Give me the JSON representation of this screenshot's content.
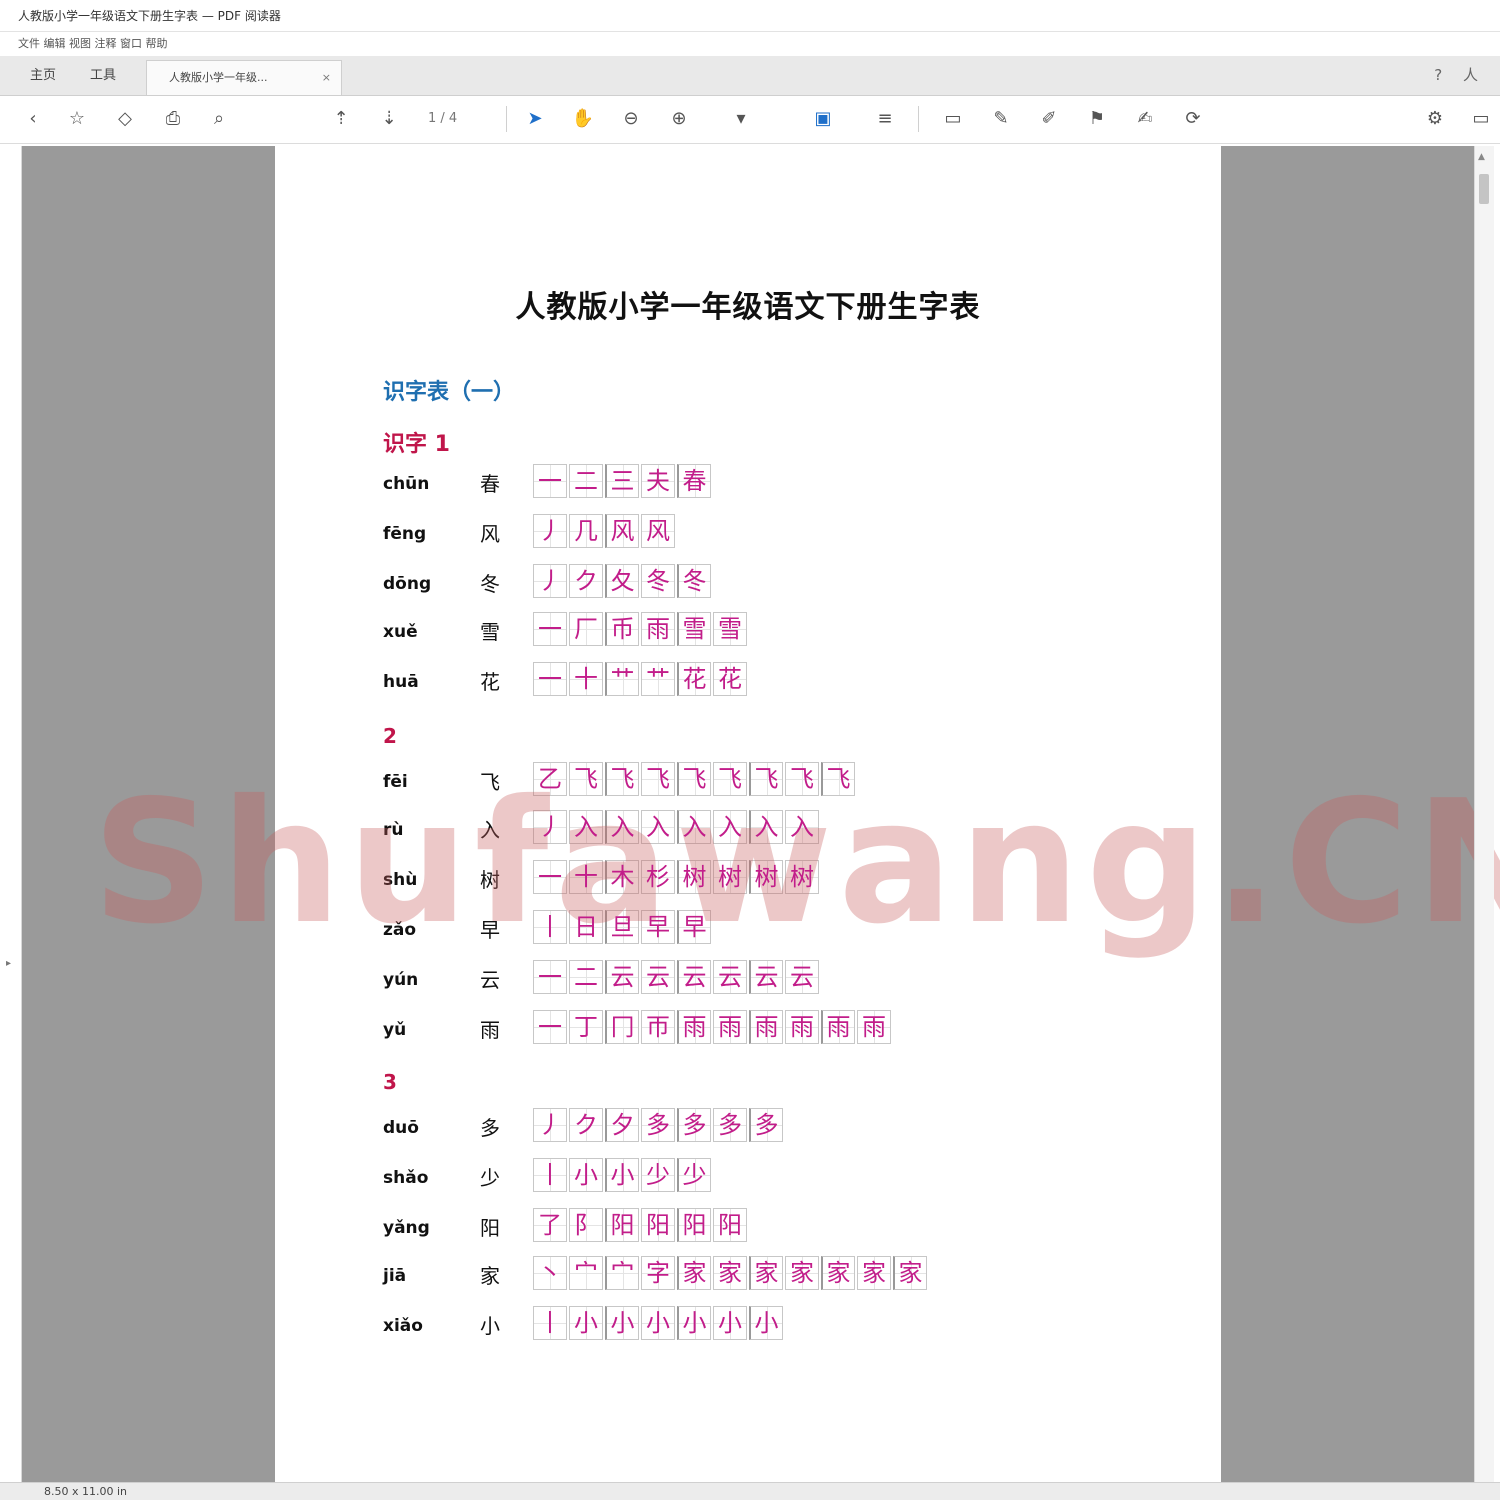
{
  "window": {
    "title": "人教版小学一年级语文下册生字表 — PDF 阅读器",
    "menu": "文件  编辑  视图  注释  窗口  帮助"
  },
  "tabs": {
    "home": "主页",
    "tools": "工具",
    "doc_tab": "人教版小学一年级...",
    "close": "×",
    "right_icons": [
      "?",
      "人"
    ]
  },
  "toolbar": {
    "page_indicator": "1 / 4"
  },
  "document": {
    "title": "人教版小学一年级语文下册生字表",
    "section_title": "识字表（一）",
    "lesson_1_label": "识字 1",
    "lesson_2_label": "2",
    "lesson_3_label": "3",
    "rows": [
      {
        "pinyin": "chūn",
        "hanzi": "春",
        "strokes": [
          "一",
          "二",
          "三",
          "夫",
          "春"
        ]
      },
      {
        "pinyin": "fēng",
        "hanzi": "风",
        "strokes": [
          "丿",
          "几",
          "风",
          "风"
        ]
      },
      {
        "pinyin": "dōng",
        "hanzi": "冬",
        "strokes": [
          "丿",
          "ク",
          "夂",
          "冬",
          "冬"
        ]
      },
      {
        "pinyin": "xuě",
        "hanzi": "雪",
        "strokes": [
          "一",
          "厂",
          "币",
          "雨",
          "雪",
          "雪"
        ]
      },
      {
        "pinyin": "huā",
        "hanzi": "花",
        "strokes": [
          "一",
          "十",
          "艹",
          "艹",
          "花",
          "花"
        ]
      },
      {
        "pinyin": "fēi",
        "hanzi": "飞",
        "strokes": [
          "乙",
          "飞",
          "飞",
          "飞",
          "飞",
          "飞",
          "飞",
          "飞",
          "飞"
        ]
      },
      {
        "pinyin": "rù",
        "hanzi": "入",
        "strokes": [
          "丿",
          "入",
          "入",
          "入",
          "入",
          "入",
          "入",
          "入"
        ]
      },
      {
        "pinyin": "shù",
        "hanzi": "树",
        "strokes": [
          "一",
          "十",
          "木",
          "杉",
          "树",
          "树",
          "树",
          "树"
        ]
      },
      {
        "pinyin": "zǎo",
        "hanzi": "早",
        "strokes": [
          "丨",
          "日",
          "旦",
          "早",
          "早"
        ]
      },
      {
        "pinyin": "yún",
        "hanzi": "云",
        "strokes": [
          "一",
          "二",
          "云",
          "云",
          "云",
          "云",
          "云",
          "云"
        ]
      },
      {
        "pinyin": "yǔ",
        "hanzi": "雨",
        "strokes": [
          "一",
          "丁",
          "冂",
          "帀",
          "雨",
          "雨",
          "雨",
          "雨",
          "雨",
          "雨"
        ]
      },
      {
        "pinyin": "duō",
        "hanzi": "多",
        "strokes": [
          "丿",
          "ク",
          "夕",
          "多",
          "多",
          "多",
          "多"
        ]
      },
      {
        "pinyin": "shǎo",
        "hanzi": "少",
        "strokes": [
          "丨",
          "小",
          "小",
          "少",
          "少"
        ]
      },
      {
        "pinyin": "yǎng",
        "hanzi": "阳",
        "strokes": [
          "了",
          "阝",
          "阳",
          "阳",
          "阳",
          "阳"
        ]
      },
      {
        "pinyin": "jiā",
        "hanzi": "家",
        "strokes": [
          "丶",
          "宀",
          "宀",
          "字",
          "家",
          "家",
          "家",
          "家",
          "家",
          "家",
          "家"
        ]
      },
      {
        "pinyin": "xiǎo",
        "hanzi": "小",
        "strokes": [
          "丨",
          "小",
          "小",
          "小",
          "小",
          "小",
          "小"
        ]
      }
    ],
    "watermark": "Shufawang.CN"
  },
  "status": {
    "text": "8.50 x 11.00 in"
  }
}
